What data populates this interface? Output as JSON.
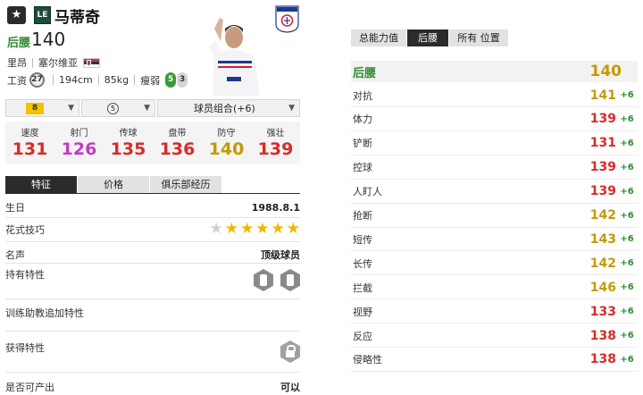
{
  "header": {
    "star_icon": "star-icon",
    "position_badge": "LE",
    "player_name": "马蒂奇",
    "position": "后腰",
    "overall": "140",
    "club": "里昂",
    "nationality": "塞尔维亚",
    "wage_label": "工资",
    "wage": "27",
    "height": "194cm",
    "weight": "85kg",
    "body_type": "瘦弱",
    "left_foot": "5",
    "right_foot": "3"
  },
  "controls": {
    "grade": "8",
    "enhance_level": "5",
    "combo_label": "球员组合(+6)",
    "dropdown_icon": "chevron-down-icon"
  },
  "main_stats": [
    {
      "label": "速度",
      "value": "131",
      "color": "#d62b2b"
    },
    {
      "label": "射门",
      "value": "126",
      "color": "#c43ac4"
    },
    {
      "label": "传球",
      "value": "135",
      "color": "#d62b2b"
    },
    {
      "label": "盘带",
      "value": "136",
      "color": "#d62b2b"
    },
    {
      "label": "防守",
      "value": "140",
      "color": "#c49a00"
    },
    {
      "label": "强壮",
      "value": "139",
      "color": "#d62b2b"
    }
  ],
  "left_tabs": [
    {
      "label": "特征",
      "active": true
    },
    {
      "label": "价格",
      "active": false
    },
    {
      "label": "俱乐部经历",
      "active": false
    }
  ],
  "profile": {
    "birthday_label": "生日",
    "birthday": "1988.8.1",
    "skill_label": "花式技巧",
    "skill_stars": 5,
    "skill_max": 6,
    "fame_label": "名声",
    "fame": "顶级球员",
    "traits_label": "持有特性",
    "coach_traits_label": "训练助教追加特性",
    "obtain_traits_label": "获得特性",
    "produce_label": "是否可产出",
    "produce": "可以"
  },
  "right_tabs": [
    {
      "label": "总能力值",
      "active": false
    },
    {
      "label": "后腰",
      "active": true
    },
    {
      "label": "所有 位置",
      "active": false
    }
  ],
  "position_summary": {
    "name": "后腰",
    "value": "140",
    "name_color": "#2e8b2e",
    "value_color": "#c49a00"
  },
  "detail_stats": [
    {
      "name": "对抗",
      "value": "141",
      "bonus": "+6",
      "color": "#c49a00"
    },
    {
      "name": "体力",
      "value": "139",
      "bonus": "+6",
      "color": "#d62b2b"
    },
    {
      "name": "铲断",
      "value": "131",
      "bonus": "+6",
      "color": "#d62b2b"
    },
    {
      "name": "控球",
      "value": "139",
      "bonus": "+6",
      "color": "#d62b2b"
    },
    {
      "name": "人盯人",
      "value": "139",
      "bonus": "+6",
      "color": "#d62b2b"
    },
    {
      "name": "抢断",
      "value": "142",
      "bonus": "+6",
      "color": "#c49a00"
    },
    {
      "name": "短传",
      "value": "143",
      "bonus": "+6",
      "color": "#c49a00"
    },
    {
      "name": "长传",
      "value": "142",
      "bonus": "+6",
      "color": "#c49a00"
    },
    {
      "name": "拦截",
      "value": "146",
      "bonus": "+6",
      "color": "#c49a00"
    },
    {
      "name": "视野",
      "value": "133",
      "bonus": "+6",
      "color": "#d62b2b"
    },
    {
      "name": "反应",
      "value": "138",
      "bonus": "+6",
      "color": "#d62b2b"
    },
    {
      "name": "侵略性",
      "value": "138",
      "bonus": "+6",
      "color": "#d62b2b"
    }
  ]
}
